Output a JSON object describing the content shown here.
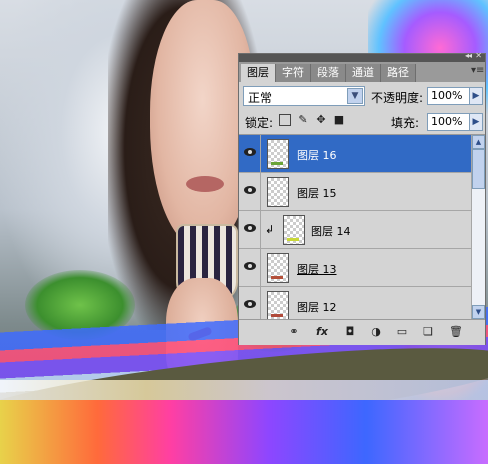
{
  "panel": {
    "tabs": [
      {
        "label": "图层",
        "active": true
      },
      {
        "label": "字符",
        "active": false
      },
      {
        "label": "段落",
        "active": false
      },
      {
        "label": "通道",
        "active": false
      },
      {
        "label": "路径",
        "active": false
      }
    ],
    "blend_mode": "正常",
    "opacity_label": "不透明度:",
    "opacity_value": "100%",
    "lock_label": "锁定:",
    "fill_label": "填充:",
    "fill_value": "100%",
    "layers": [
      {
        "name": "图层 16",
        "selected": true,
        "visible": true,
        "clipped": false
      },
      {
        "name": "图层 15",
        "selected": false,
        "visible": true,
        "clipped": false
      },
      {
        "name": "图层 14",
        "selected": false,
        "visible": true,
        "clipped": true
      },
      {
        "name": "图层 13",
        "selected": false,
        "visible": true,
        "clipped": false
      },
      {
        "name": "图层 12",
        "selected": false,
        "visible": true,
        "clipped": false
      }
    ],
    "bottom_icons": [
      "link-icon",
      "fx-icon",
      "mask-icon",
      "adjustment-icon",
      "folder-icon",
      "new-layer-icon",
      "trash-icon"
    ]
  },
  "colors": {
    "selection": "#316ac5",
    "panel_bg": "#d4d4d4"
  }
}
